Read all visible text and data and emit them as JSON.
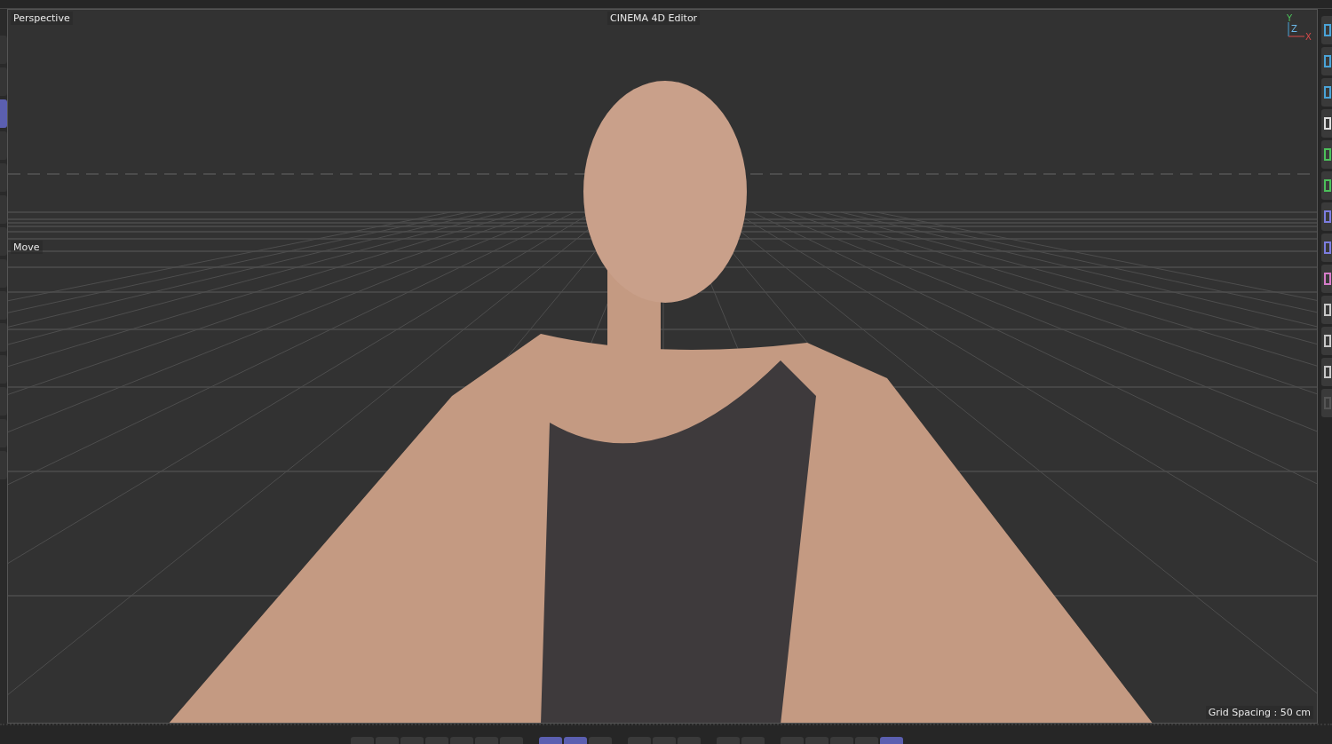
{
  "left_toolbar": [
    {
      "selected": false
    },
    {
      "selected": false
    },
    {
      "selected": true
    },
    {
      "selected": false
    },
    {
      "selected": false
    },
    {
      "selected": false
    },
    {
      "selected": false
    },
    {
      "selected": false
    },
    {
      "selected": false
    },
    {
      "selected": false
    },
    {
      "selected": false
    },
    {
      "selected": false
    },
    {
      "selected": false
    },
    {
      "selected": false
    }
  ],
  "viewport": {
    "camera_label": "Perspective",
    "title": "CINEMA 4D Editor",
    "tool_label": "Move",
    "grid_spacing": "Grid Spacing : 50 cm",
    "axes": {
      "y": "Y",
      "z": "Z",
      "x": "X"
    }
  },
  "bottom_toolbar": [
    [
      {
        "selected": false
      },
      {
        "selected": false
      },
      {
        "selected": false
      },
      {
        "selected": false
      },
      {
        "selected": false
      },
      {
        "selected": false
      },
      {
        "selected": false
      }
    ],
    [
      {
        "selected": true
      },
      {
        "selected": true
      },
      {
        "selected": false
      }
    ],
    [
      {
        "selected": false
      },
      {
        "selected": false
      },
      {
        "selected": false
      }
    ],
    [
      {
        "selected": false
      },
      {
        "selected": false
      }
    ],
    [
      {
        "selected": false
      },
      {
        "selected": false
      },
      {
        "selected": false
      },
      {
        "selected": false
      },
      {
        "selected": true
      }
    ]
  ]
}
